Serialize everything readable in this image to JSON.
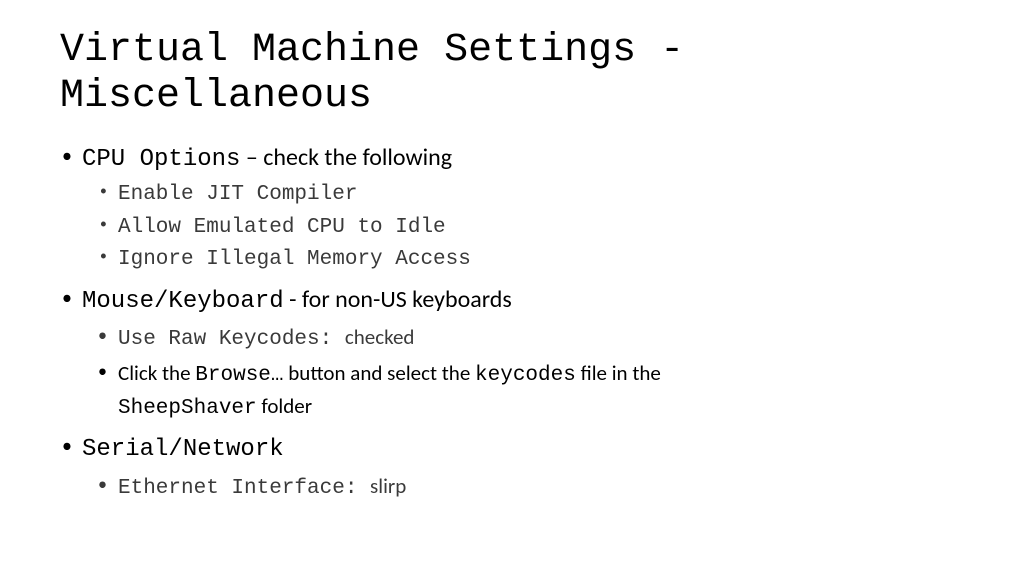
{
  "title": "Virtual Machine Settings - Miscellaneous",
  "sections": {
    "cpu": {
      "heading_mono": "CPU Options",
      "heading_rest": "  – check the following",
      "items": [
        "Enable JIT Compiler",
        "Allow Emulated CPU to Idle",
        "Ignore Illegal Memory Access"
      ]
    },
    "mousekb": {
      "heading_mono": "Mouse/Keyboard",
      "heading_rest": " - for non-US keyboards",
      "raw_label": "Use Raw Keycodes: ",
      "raw_value": "checked",
      "browse_pre": "Click the ",
      "browse_btn": "Browse…",
      "browse_mid": "  button and select the ",
      "browse_file": "keycodes",
      "browse_mid2": " file in the ",
      "browse_folder": "SheepShaver",
      "browse_post": " folder"
    },
    "serial": {
      "heading_mono": "Serial/Network",
      "eth_label": "Ethernet Interface: ",
      "eth_value": "slirp"
    }
  }
}
